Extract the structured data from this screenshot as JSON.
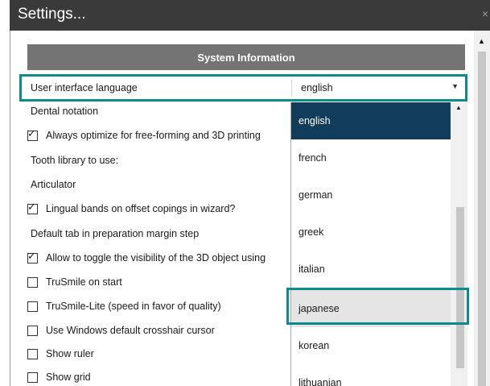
{
  "window": {
    "title": "Settings...",
    "close_label": "×"
  },
  "section": {
    "title": "System Information"
  },
  "language_setting": {
    "label": "User interface language",
    "value": "english"
  },
  "settings": [
    {
      "label": "Dental notation",
      "type": "text"
    },
    {
      "label": "Always optimize for free-forming and 3D printing",
      "type": "checkbox",
      "checked": true
    },
    {
      "label": "Tooth library to use:",
      "type": "text"
    },
    {
      "label": "Articulator",
      "type": "text"
    },
    {
      "label": "Lingual bands on offset copings in wizard?",
      "type": "checkbox",
      "checked": true
    },
    {
      "label": "Default tab in preparation margin step",
      "type": "text"
    },
    {
      "label": "Allow to toggle the visibility of the 3D object using",
      "type": "checkbox",
      "checked": true
    },
    {
      "label": "TruSmile on start",
      "type": "checkbox",
      "checked": false
    },
    {
      "label": "TruSmile-Lite (speed in favor of quality)",
      "type": "checkbox",
      "checked": false
    },
    {
      "label": "Use Windows default crosshair cursor",
      "type": "checkbox",
      "checked": false
    },
    {
      "label": "Show ruler",
      "type": "checkbox",
      "checked": false
    },
    {
      "label": "Show grid",
      "type": "checkbox",
      "checked": false
    }
  ],
  "language_options": [
    "english",
    "french",
    "german",
    "greek",
    "italian",
    "japanese",
    "korean",
    "lithuanian"
  ],
  "selected_option": "english",
  "highlighted_option": "japanese",
  "colors": {
    "title_bar": "#3a3a3a",
    "section_header": "#747474",
    "selected_option": "#123d5a",
    "highlight_border": "#0f8a8a"
  }
}
